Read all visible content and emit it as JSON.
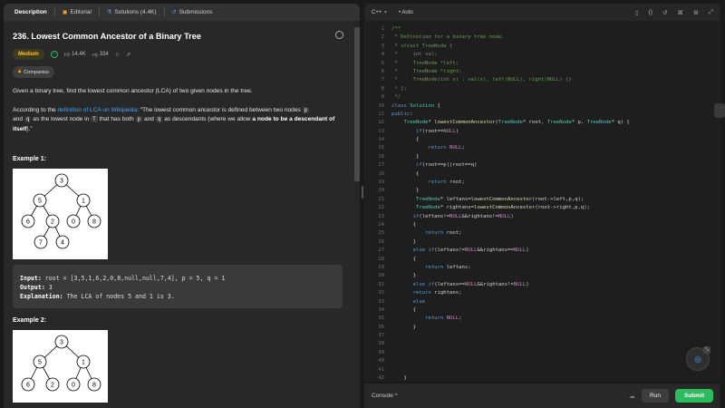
{
  "tabs": [
    {
      "label": "Description",
      "active": true
    },
    {
      "label": "Editorial",
      "icon": "editorial-icon"
    },
    {
      "label": "Solutions (4.4K)",
      "icon": "solutions-icon"
    },
    {
      "label": "Submissions",
      "icon": "submissions-icon"
    }
  ],
  "problem": {
    "title": "236. Lowest Common Ancestor of a Binary Tree",
    "difficulty": "Medium",
    "likes": "14.4K",
    "dislikes": "334",
    "companies_label": "Companies",
    "desc1": "Given a binary tree, find the lowest common ancestor (LCA) of two given nodes in the tree.",
    "desc2_pre": "According to the ",
    "desc2_link": "definition of LCA on Wikipedia",
    "desc2_mid1": ": “The lowest common ancestor is defined between two nodes ",
    "p": "p",
    "and": " and ",
    "q": "q",
    "desc2_mid2": " as the lowest node in ",
    "T": "T",
    "desc2_mid3": " that has both ",
    "desc2_mid4": " as descendants (where we allow ",
    "desc2_bold": "a node to be a descendant of itself",
    "desc2_end": ").”"
  },
  "example1": {
    "heading": "Example 1:",
    "input_label": "Input:",
    "input_value": " root = [3,5,1,6,2,0,8,null,null,7,4], p = 5, q = 1",
    "output_label": "Output:",
    "output_value": " 3",
    "explanation_label": "Explanation:",
    "explanation_value": " The LCA of nodes 5 and 1 is 3.",
    "tree": [
      "3",
      "5",
      "1",
      "6",
      "2",
      "0",
      "8",
      "7",
      "4"
    ]
  },
  "example2": {
    "heading": "Example 2:",
    "tree": [
      "3",
      "5",
      "1",
      "6",
      "2",
      "0",
      "8"
    ]
  },
  "editor": {
    "language": "C++",
    "mode": "Auto",
    "lines": [
      "/**",
      " * Definition for a binary tree node.",
      " * struct TreeNode {",
      " *     int val;",
      " *     TreeNode *left;",
      " *     TreeNode *right;",
      " *     TreeNode(int x) : val(x), left(NULL), right(NULL) {}",
      " * };",
      " */",
      "class Solution {",
      "public:",
      "    TreeNode* lowestCommonAncestor(TreeNode* root, TreeNode* p, TreeNode* q) {",
      "        if(root==NULL)",
      "        {",
      "            return NULL;",
      "        }",
      "        if(root==p||root==q)",
      "        {",
      "            return root;",
      "        }",
      "        TreeNode* leftans=lowestCommonAncestor(root->left,p,q);",
      "        TreeNode* rightans=lowestCommonAncestor(root->right,p,q);",
      "       if(leftans!=NULL&&rightans!=NULL)",
      "       {",
      "           return root;",
      "       }",
      "       else if(leftans!=NULL&&rightans==NULL)",
      "       {",
      "           return leftans;",
      "       }",
      "       else if(leftans==NULL&&rightans!=NULL)",
      "       return rightans;",
      "       else",
      "       {",
      "           return NULL;",
      "       }",
      "",
      "",
      "",
      "",
      "",
      "    }"
    ]
  },
  "console": {
    "label": "Console",
    "run": "Run",
    "submit": "Submit"
  }
}
